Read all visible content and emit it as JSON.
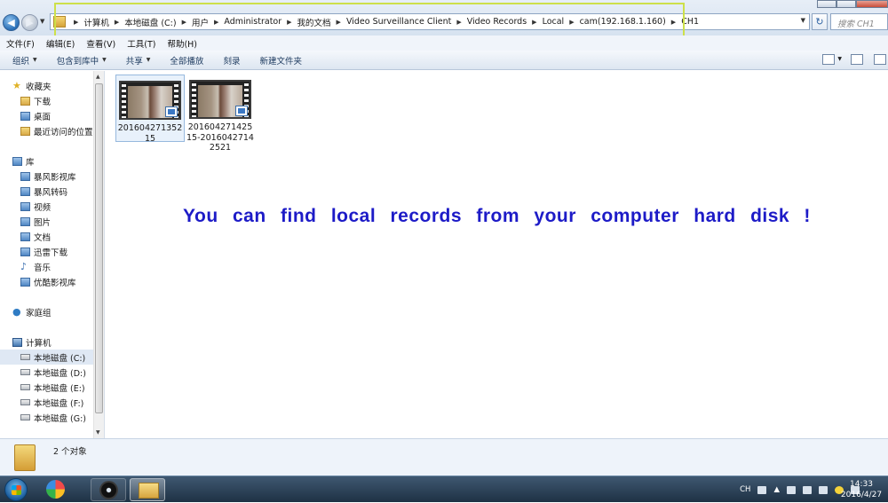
{
  "window": {
    "address_crumbs": [
      "计算机",
      "本地磁盘 (C:)",
      "用户",
      "Administrator",
      "我的文档",
      "Video Surveillance Client",
      "Video Records",
      "Local",
      "cam(192.168.1.160)",
      "CH1"
    ],
    "search_placeholder": "搜索 CH1"
  },
  "menubar": {
    "items": [
      "文件(F)",
      "编辑(E)",
      "查看(V)",
      "工具(T)",
      "帮助(H)"
    ]
  },
  "commandbar": {
    "organize": "组织",
    "include_in_library": "包含到库中",
    "share": "共享",
    "play_all": "全部播放",
    "burn": "刻录",
    "new_folder": "新建文件夹"
  },
  "navpane": {
    "favorites": {
      "label": "收藏夹",
      "items": [
        "下载",
        "桌面",
        "最近访问的位置"
      ]
    },
    "libraries": {
      "label": "库",
      "items": [
        "暴风影视库",
        "暴风转码",
        "视频",
        "图片",
        "文档",
        "迅雷下载",
        "音乐",
        "优酷影视库"
      ]
    },
    "homegroup": {
      "label": "家庭组"
    },
    "computer": {
      "label": "计算机",
      "items": [
        "本地磁盘 (C:)",
        "本地磁盘 (D:)",
        "本地磁盘 (E:)",
        "本地磁盘 (F:)",
        "本地磁盘 (G:)"
      ]
    }
  },
  "files": [
    {
      "name": "20160427135215"
    },
    {
      "name": "20160427142515-20160427142521"
    }
  ],
  "overlay_text": "You can find local records from your computer hard disk !",
  "details": {
    "count_text": "2 个对象"
  },
  "taskbar": {
    "tray_lang": "CH",
    "time": "14:33",
    "date": "2016/4/27"
  },
  "colors": {
    "overlay": "#1d1bc7",
    "highlight_box": "#cde04a"
  }
}
